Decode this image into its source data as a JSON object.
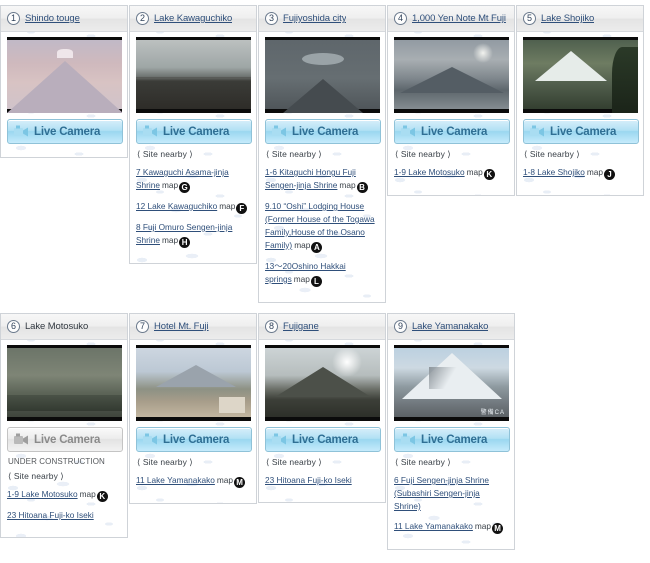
{
  "colors": {
    "link": "#2f4f7a",
    "button_bg": "#9ad7f0",
    "button_border": "#8fc2d8",
    "button_text": "#2f6f94",
    "badge_bg": "#111111",
    "card_border": "#cfd3d8",
    "header_bg": "#ececec"
  },
  "labels": {
    "live_camera": "Live Camera",
    "site_nearby": "⟨ Site nearby ⟩",
    "under_construction": "UNDER CONSTRUCTION",
    "map": "map",
    "camera_icon": "video-camera-icon"
  },
  "cards": [
    {
      "number": "1",
      "title": "Shindo touge",
      "title_is_link": true,
      "scene": "sc1",
      "live_camera_enabled": true,
      "under_construction": false,
      "has_site_nearby": false,
      "nearby": []
    },
    {
      "number": "2",
      "title": "Lake Kawaguchiko",
      "title_is_link": true,
      "scene": "sc2",
      "live_camera_enabled": true,
      "under_construction": false,
      "has_site_nearby": true,
      "nearby": [
        {
          "text": "7 Kawaguchi Asama-jinja Shrine",
          "map": "map",
          "badge": "G"
        },
        {
          "text": "12 Lake Kawaguchiko",
          "map": "map",
          "badge": "F"
        },
        {
          "text": "8 Fuji Omuro Sengen-jinja Shrine",
          "map": "map",
          "badge": "H"
        }
      ]
    },
    {
      "number": "3",
      "title": "Fujiyoshida city",
      "title_is_link": true,
      "scene": "sc3",
      "live_camera_enabled": true,
      "under_construction": false,
      "has_site_nearby": true,
      "nearby": [
        {
          "text": "1-6 Kitaguchi Hongu Fuji Sengen-jinja Shrine",
          "map": "map",
          "badge": "B"
        },
        {
          "text": "9.10 “Oshi” Lodging House (Former House of the Togawa Family,House of the Osano Family)",
          "map": "map",
          "badge": "A"
        },
        {
          "text": "13～20Oshino Hakkai springs",
          "map": "map",
          "badge": "L"
        }
      ]
    },
    {
      "number": "4",
      "title": "1,000 Yen Note Mt Fuji",
      "title_is_link": true,
      "scene": "sc4",
      "live_camera_enabled": true,
      "under_construction": false,
      "has_site_nearby": true,
      "nearby": [
        {
          "text": "1-9 Lake Motosuko",
          "map": "map",
          "badge": "K"
        }
      ]
    },
    {
      "number": "5",
      "title": "Lake Shojiko",
      "title_is_link": true,
      "scene": "sc5",
      "live_camera_enabled": true,
      "under_construction": false,
      "has_site_nearby": true,
      "nearby": [
        {
          "text": "1-8 Lake Shojiko",
          "map": "map",
          "badge": "J"
        }
      ]
    },
    {
      "number": "6",
      "title": "Lake Motosuko",
      "title_is_link": false,
      "scene": "sc6",
      "live_camera_enabled": false,
      "under_construction": true,
      "has_site_nearby": true,
      "nearby": [
        {
          "text": "1-9 Lake Motosuko",
          "map": "map",
          "badge": "K"
        },
        {
          "text": "23 Hitoana Fuji-ko Iseki",
          "map": "",
          "badge": ""
        }
      ]
    },
    {
      "number": "7",
      "title": "Hotel Mt. Fuji",
      "title_is_link": true,
      "scene": "sc7",
      "live_camera_enabled": true,
      "under_construction": false,
      "has_site_nearby": true,
      "nearby": [
        {
          "text": "11 Lake Yamanakako",
          "map": "map",
          "badge": "M"
        }
      ]
    },
    {
      "number": "8",
      "title": "Fujigane",
      "title_is_link": true,
      "scene": "sc8",
      "live_camera_enabled": true,
      "under_construction": false,
      "has_site_nearby": true,
      "nearby": [
        {
          "text": "23 Hitoana Fuji-ko Iseki",
          "map": "",
          "badge": ""
        }
      ]
    },
    {
      "number": "9",
      "title": "Lake Yamanakako",
      "title_is_link": true,
      "scene": "sc9",
      "live_camera_enabled": true,
      "under_construction": false,
      "has_site_nearby": true,
      "watermark": "警備CA",
      "nearby": [
        {
          "text": "6 Fuji Sengen-jinja Shrine (Subashiri Sengen-jinja Shrine)",
          "map": "",
          "badge": ""
        },
        {
          "text": "11 Lake Yamanakako",
          "map": "map",
          "badge": "M"
        }
      ]
    }
  ]
}
